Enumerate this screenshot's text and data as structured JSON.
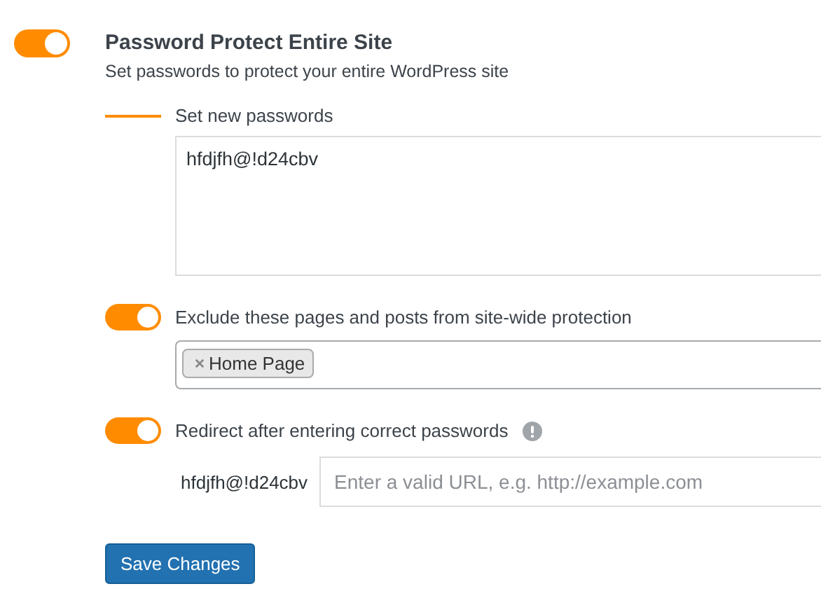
{
  "main_setting": {
    "title": "Password Protect Entire Site",
    "description": "Set passwords to protect your entire WordPress site",
    "on": true
  },
  "passwords": {
    "label": "Set new passwords",
    "value": "hfdjfh@!d24cbv"
  },
  "options": [
    {
      "kind": "tags",
      "label": "Exclude these pages and posts from site-wide protection",
      "on": true,
      "tags": [
        "Home Page"
      ]
    },
    {
      "kind": "redirect",
      "label": "Redirect after entering correct passwords",
      "on": true,
      "field_label": "hfdjfh@!d24cbv",
      "placeholder": "Enter a valid URL, e.g. http://example.com"
    }
  ],
  "save_button": "Save Changes"
}
